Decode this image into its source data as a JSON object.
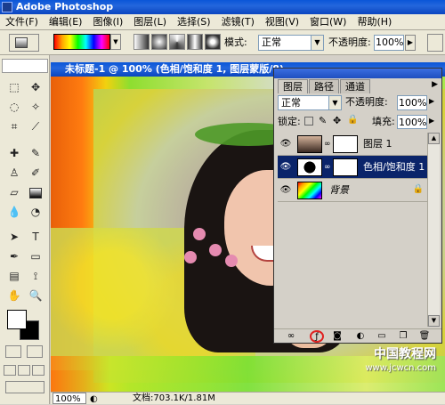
{
  "app": {
    "title": "Adobe Photoshop"
  },
  "menu": [
    "文件(F)",
    "编辑(E)",
    "图像(I)",
    "图层(L)",
    "选择(S)",
    "滤镜(T)",
    "视图(V)",
    "窗口(W)",
    "帮助(H)"
  ],
  "options": {
    "mode_label": "模式:",
    "mode_value": "正常",
    "opacity_label": "不透明度:",
    "opacity_value": "100%"
  },
  "document": {
    "title": "未标题-1 @ 100% (色相/饱和度 1, 图层蒙版/8)",
    "zoom": "100%",
    "doc_info": "文档:703.1K/1.81M"
  },
  "layers_panel": {
    "tabs": [
      "图层",
      "路径",
      "通道"
    ],
    "blend_mode": "正常",
    "opacity_label": "不透明度:",
    "opacity_value": "100%",
    "lock_label": "锁定:",
    "fill_label": "填充:",
    "fill_value": "100%",
    "layers": [
      {
        "name": "图层 1",
        "selected": false
      },
      {
        "name": "色相/饱和度 1",
        "selected": true
      },
      {
        "name": "背景",
        "selected": false,
        "locked": true
      }
    ]
  },
  "watermark": {
    "cn": "中国教程网",
    "url": "www.jcwcn.com"
  },
  "colors": {
    "title_blue": "#0a56d8",
    "selected_layer": "#0a246a",
    "highlight_circle": "#e02020"
  }
}
